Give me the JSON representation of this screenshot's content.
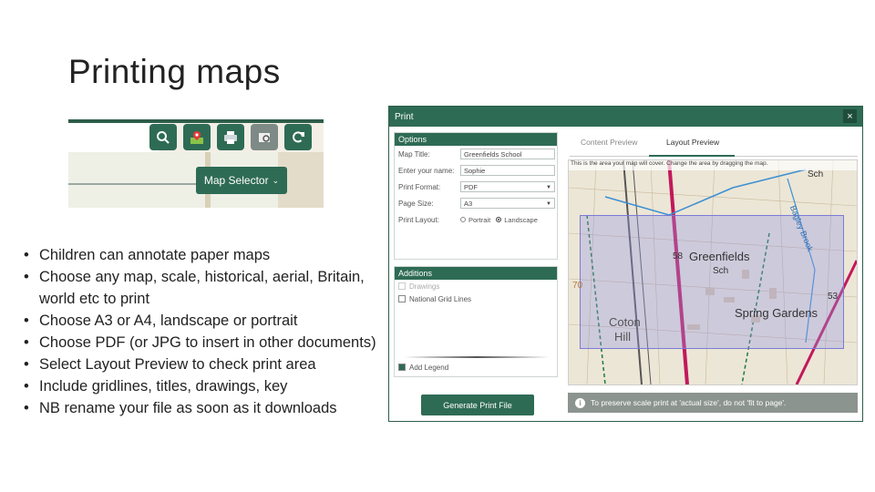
{
  "slide": {
    "title": "Printing maps"
  },
  "toolbar": {
    "buttons": [
      "search-icon",
      "map-pin-icon",
      "printer-icon",
      "print-preview-icon",
      "refresh-icon"
    ],
    "map_selector_label": "Map Selector"
  },
  "bullets": [
    "Children can annotate paper maps",
    "Choose any map, scale, historical, aerial, Britain, world etc to print",
    "Choose A3 or A4, landscape or portrait",
    "Choose PDF (or JPG to insert in other documents)",
    "Select Layout Preview to check print area",
    "Include gridlines, titles, drawings, key",
    "NB rename your file as soon as it downloads"
  ],
  "dialog": {
    "title": "Print",
    "close_label": "×",
    "options": {
      "heading": "Options",
      "map_title_label": "Map Title:",
      "map_title_value": "Greenfields School",
      "name_label": "Enter your name:",
      "name_value": "Sophie",
      "format_label": "Print Format:",
      "format_value": "PDF",
      "page_size_label": "Page Size:",
      "page_size_value": "A3",
      "layout_label": "Print Layout:",
      "layout_portrait": "Portrait",
      "layout_landscape": "Landscape",
      "layout_selected": "Landscape"
    },
    "additions": {
      "heading": "Additions",
      "drawings": "Drawings",
      "grid_lines": "National Grid Lines",
      "add_legend": "Add Legend",
      "add_legend_checked": true
    },
    "generate_label": "Generate Print File",
    "tabs": {
      "content_preview": "Content Preview",
      "layout_preview": "Layout Preview",
      "active": "Layout Preview"
    },
    "map_note": "This is the area your map will cover. Change the area by dragging the map.",
    "map_labels": {
      "greenfields": "Greenfields",
      "spring_gardens": "Spring Gardens",
      "coton": "Coton",
      "hill": "Hill",
      "bagley_brook": "Bagley Brook",
      "sch1": "Sch",
      "sch2": "Sch",
      "n58": "58",
      "n70": "70",
      "n53": "53"
    },
    "footnote": "To preserve scale print at 'actual size', do not 'fit to page'."
  }
}
